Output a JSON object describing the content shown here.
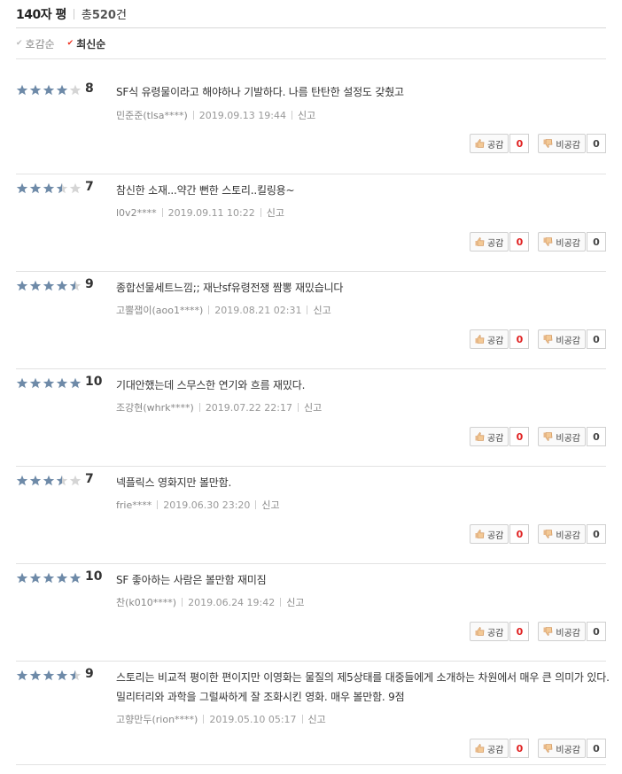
{
  "header": {
    "title": "140자 평",
    "total_prefix": "총",
    "total_count": "520",
    "total_suffix": "건"
  },
  "sort": [
    {
      "label": "호감순",
      "active": false
    },
    {
      "label": "최신순",
      "active": true
    }
  ],
  "labels": {
    "like": "공감",
    "dislike": "비공감",
    "report": "신고"
  },
  "reviews": [
    {
      "rating": 8,
      "text": "SF식 유령물이라고 해야하나 기발하다. 나름 탄탄한 설정도 갖췄고",
      "author": "민준준(tlsa****)",
      "date": "2019.09.13 19:44",
      "likes": "0",
      "dislikes": "0"
    },
    {
      "rating": 7,
      "text": "참신한 소재...약간 뻔한 스토리..킬링용~",
      "author": "l0v2****",
      "date": "2019.09.11 10:22",
      "likes": "0",
      "dislikes": "0"
    },
    {
      "rating": 9,
      "text": "종합선물세트느낌;; 재난sf유령전쟁 짬뽕 재밌습니다",
      "author": "고뿔잽이(aoo1****)",
      "date": "2019.08.21 02:31",
      "likes": "0",
      "dislikes": "0"
    },
    {
      "rating": 10,
      "text": "기대안했는데 스무스한 연기와 흐름 재밌다.",
      "author": "조강현(whrk****)",
      "date": "2019.07.22 22:17",
      "likes": "0",
      "dislikes": "0"
    },
    {
      "rating": 7,
      "text": "넥플릭스 영화지만 볼만함.",
      "author": "frie****",
      "date": "2019.06.30 23:20",
      "likes": "0",
      "dislikes": "0"
    },
    {
      "rating": 10,
      "text": "SF 좋아하는 사람은 볼만함 재미짐",
      "author": "찬(k010****)",
      "date": "2019.06.24 19:42",
      "likes": "0",
      "dislikes": "0"
    },
    {
      "rating": 9,
      "text": "스토리는 비교적 평이한 편이지만 이영화는 물질의 제5상태를 대중들에게 소개하는 차원에서 매우 큰 의미가 있다. 밀리터리와 과학을 그럴싸하게 잘 조화시킨 영화. 매우 볼만함. 9점",
      "author": "고향만두(rion****)",
      "date": "2019.05.10 05:17",
      "likes": "0",
      "dislikes": "0"
    }
  ],
  "colors": {
    "star": "#6e8aa8",
    "star_empty": "#d5d5d5",
    "like_count": "#e02020",
    "check_active": "#e32222"
  }
}
